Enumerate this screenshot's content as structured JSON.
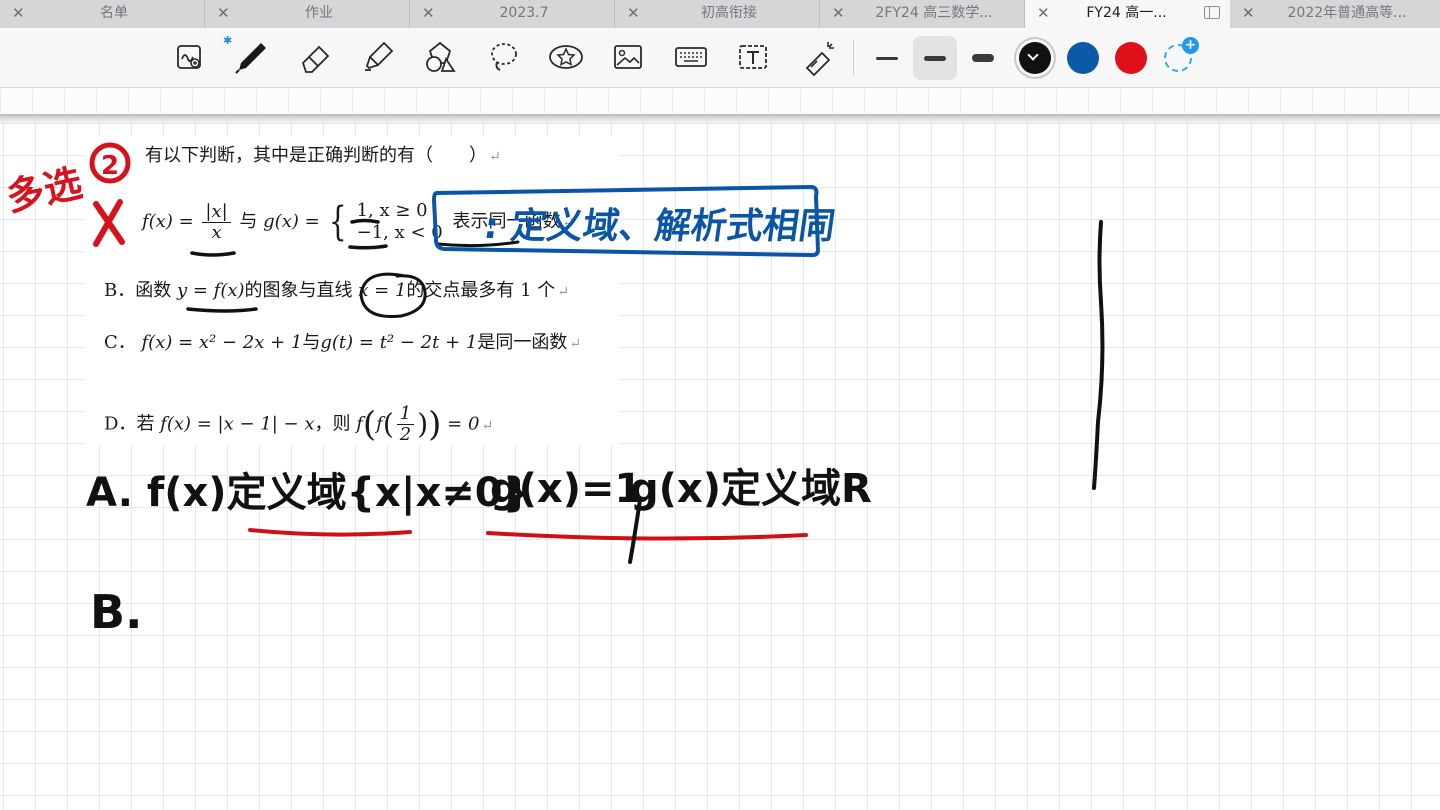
{
  "tabs": [
    {
      "title": "名单",
      "active": false
    },
    {
      "title": "作业",
      "active": false
    },
    {
      "title": "2023.7",
      "active": false
    },
    {
      "title": "初高衔接",
      "active": false
    },
    {
      "title": "2FY24 高三数学...",
      "active": false
    },
    {
      "title": "FY24 高一...",
      "active": true
    },
    {
      "title": "2022年普通高等...",
      "active": false
    }
  ],
  "toolbar": {
    "tools": [
      "lasso-zoom-icon",
      "pen-icon",
      "eraser-icon",
      "highlighter-icon",
      "shapes-icon",
      "lasso-icon",
      "sticker-icon",
      "image-icon",
      "keyboard-icon",
      "text-box-icon",
      "laser-pointer-icon"
    ],
    "pen_widths": [
      "thin",
      "medium",
      "thick"
    ],
    "selected_width": "medium",
    "colors": [
      "#111111",
      "#0a5aa8",
      "#e0101a"
    ],
    "selected_color": "#111111",
    "accent": "#2196f3"
  },
  "question": {
    "stem": "有以下判断，其中是正确判断的有（　　）",
    "option_a": {
      "f_lhs": "f(x) =",
      "f_num": "|x|",
      "f_den": "x",
      "conj": "与",
      "g_lhs": "g(x) =",
      "case1": "1, x ≥ 0",
      "case2": "−1, x < 0",
      "tail": "表示同一函数"
    },
    "option_b": {
      "label": "B．",
      "text1": "函数",
      "expr1": "y = f(x)",
      "text2": "的图象与直线",
      "expr2": "x = 1",
      "text3": "的交点最多有 1 个"
    },
    "option_c": {
      "label": "C．",
      "expr1": "f(x) = x² − 2x + 1",
      "conj": "与",
      "expr2": "g(t) = t² − 2t + 1",
      "text": "是同一函数"
    },
    "option_d": {
      "label": "D．",
      "text1": "若",
      "expr1": "f(x) = |x − 1| − x",
      "text2": "，则",
      "expr2a": "f",
      "expr2b": "f",
      "half_num": "1",
      "half_den": "2",
      "expr2c": "= 0"
    },
    "return_mark": "↵"
  },
  "handwriting": {
    "multi_choice": "多选",
    "number": "2",
    "boxed_note": ": 定义域、解析式相同",
    "line_a": "A. f(x)定义域{x|x≠0}",
    "line_a2": "g(x)=1",
    "line_a3": "g(x)定义域R",
    "line_b": "B."
  }
}
